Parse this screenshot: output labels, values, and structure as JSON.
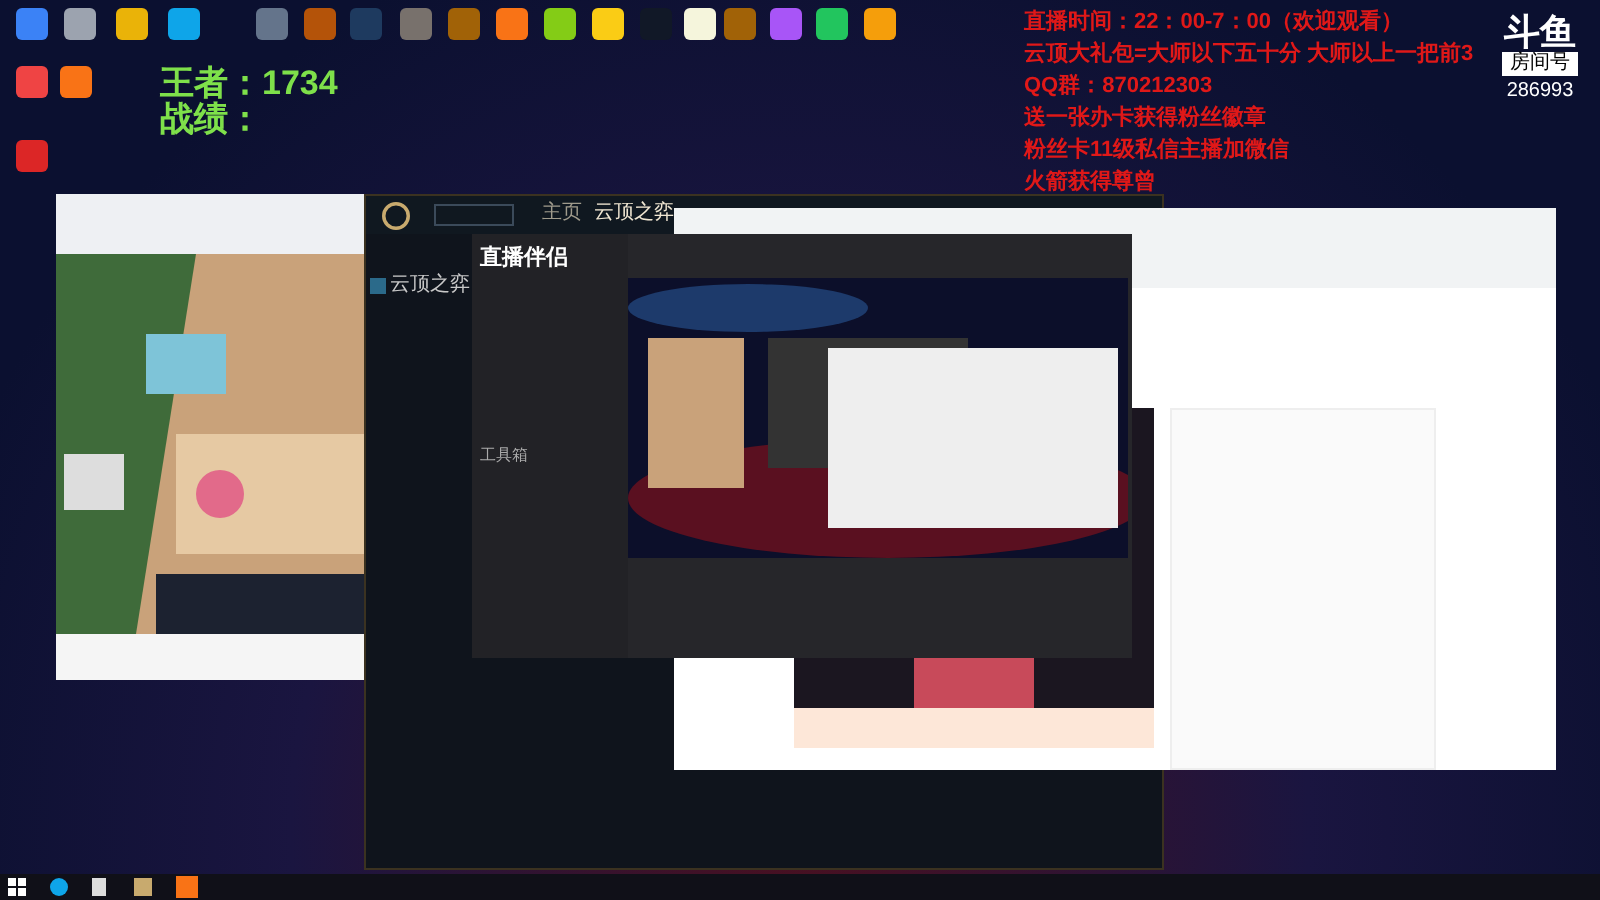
{
  "desktop_icons": [
    {
      "color": "#3b82f6"
    },
    {
      "color": "#9ca3af"
    },
    {
      "color": "#eab308"
    },
    {
      "color": "#0ea5e9"
    },
    {
      "color": "#64748b"
    },
    {
      "color": "#b45309"
    },
    {
      "color": "#1e3a5f"
    },
    {
      "color": "#78716c"
    },
    {
      "color": "#a16207"
    },
    {
      "color": "#f97316"
    },
    {
      "color": "#84cc16"
    },
    {
      "color": "#facc15"
    },
    {
      "color": "#111827"
    },
    {
      "color": "#f5f5dc"
    },
    {
      "color": "#a16207"
    },
    {
      "color": "#a855f7"
    },
    {
      "color": "#22c55e"
    },
    {
      "color": "#f59e0b"
    }
  ],
  "desktop_icons_column": [
    {
      "color": "#ef4444"
    },
    {
      "color": "#f97316"
    },
    {
      "color": "#dc2626"
    }
  ],
  "stats": {
    "rank": "王者：1734",
    "record": "战绩："
  },
  "announcement": [
    "直播时间：22：00-7：00（欢迎观看）",
    "云顶大礼包=大师以下五十分 大师以上一把前3",
    "QQ群：870212303",
    "送一张办卡获得粉丝徽章",
    "粉丝卡11级私信主播加微信",
    "火箭获得尊曾"
  ],
  "douyu_badge": {
    "logo": "斗鱼",
    "room_label": "房间号",
    "room_id": "286993"
  },
  "lol_client": {
    "nav": [
      {
        "label": "主页",
        "selected": false
      },
      {
        "label": "云顶之弈",
        "selected": true
      }
    ],
    "sidebar_item": "云顶之弈"
  },
  "streaming_app": {
    "title": "直播伴侣",
    "toolbox_label": "工具箱"
  }
}
